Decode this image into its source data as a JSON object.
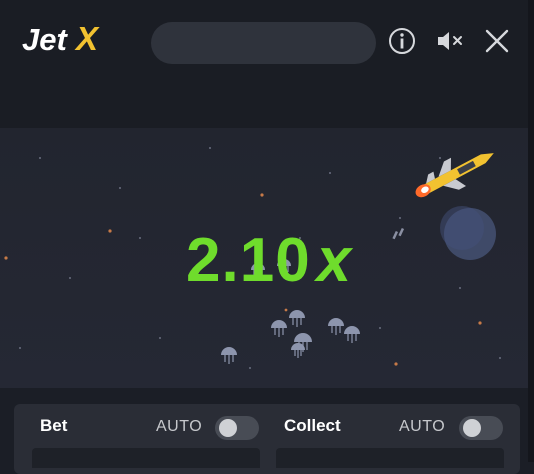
{
  "app": {
    "brand": "JetX"
  },
  "header": {
    "icons": [
      "info-icon",
      "sound-muted-icon",
      "close-icon"
    ]
  },
  "game": {
    "multiplier_value": "2.10",
    "multiplier_suffix": "x",
    "multiplier_color": "#6fdc2c",
    "planet_color": "#3f4a68"
  },
  "controls": {
    "bet": {
      "label": "Bet",
      "auto_label": "AUTO",
      "auto_enabled": false
    },
    "collect": {
      "label": "Collect",
      "auto_label": "AUTO",
      "auto_enabled": false
    }
  },
  "colors": {
    "background": "#1b1e26",
    "panel": "#2a2d36",
    "accent_yellow": "#f2c230"
  }
}
